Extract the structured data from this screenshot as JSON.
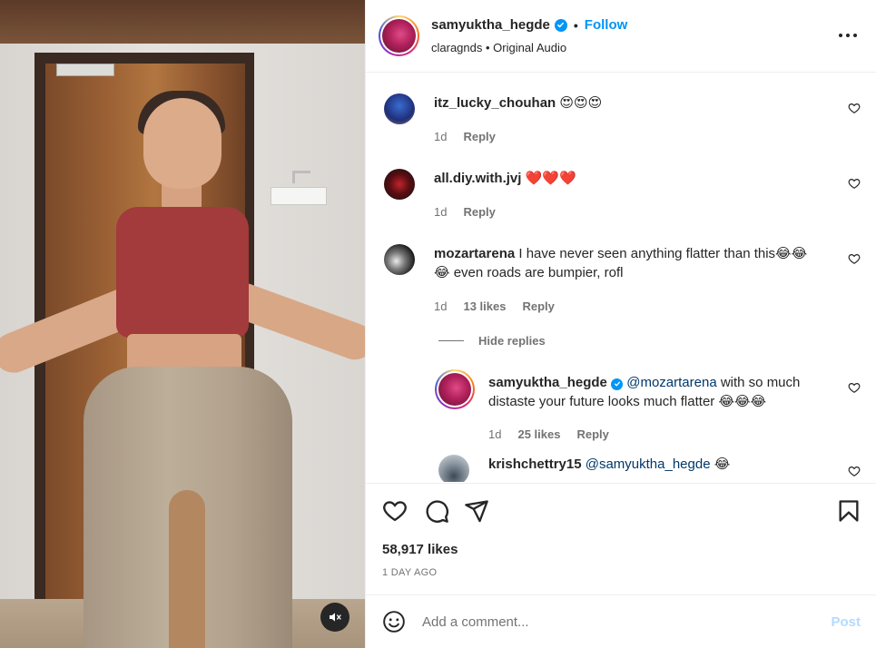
{
  "header": {
    "username": "samyuktha_hegde",
    "separator": "•",
    "follow_label": "Follow",
    "subtitle": "claragnds • Original Audio"
  },
  "comments": [
    {
      "username": "itz_lucky_chouhan",
      "text": "😍😍😍",
      "time": "1d",
      "likes": "",
      "reply_label": "Reply"
    },
    {
      "username": "all.diy.with.jvj",
      "text": "❤️❤️❤️",
      "time": "1d",
      "likes": "",
      "reply_label": "Reply"
    },
    {
      "username": "mozartarena",
      "text_line1": "I have never seen anything flatter than this😂😂",
      "text_line2": "😂 even roads are bumpier, rofl",
      "time": "1d",
      "likes": "13 likes",
      "reply_label": "Reply"
    }
  ],
  "hide_replies_label": "Hide replies",
  "replies": [
    {
      "username": "samyuktha_hegde",
      "mention": "@mozartarena",
      "text_line1": " with so much",
      "text_line2": "distaste your future looks much flatter 😂😂😂",
      "time": "1d",
      "likes": "25 likes",
      "reply_label": "Reply"
    },
    {
      "username": "krishchettry15",
      "mention": "@samyuktha_hegde",
      "text_line1": " 😂"
    }
  ],
  "actions": {
    "likes": "58,917 likes",
    "date": "1 DAY AGO"
  },
  "add_comment": {
    "placeholder": "Add a comment...",
    "post_label": "Post"
  },
  "colors": {
    "accent": "#0095f6",
    "text": "#262626",
    "muted": "#737373",
    "post_disabled": "#b3dbff"
  },
  "icons": [
    "verified-badge-icon",
    "more-options-icon",
    "heart-icon",
    "comment-icon",
    "share-icon",
    "bookmark-icon",
    "emoji-icon",
    "mute-icon"
  ]
}
